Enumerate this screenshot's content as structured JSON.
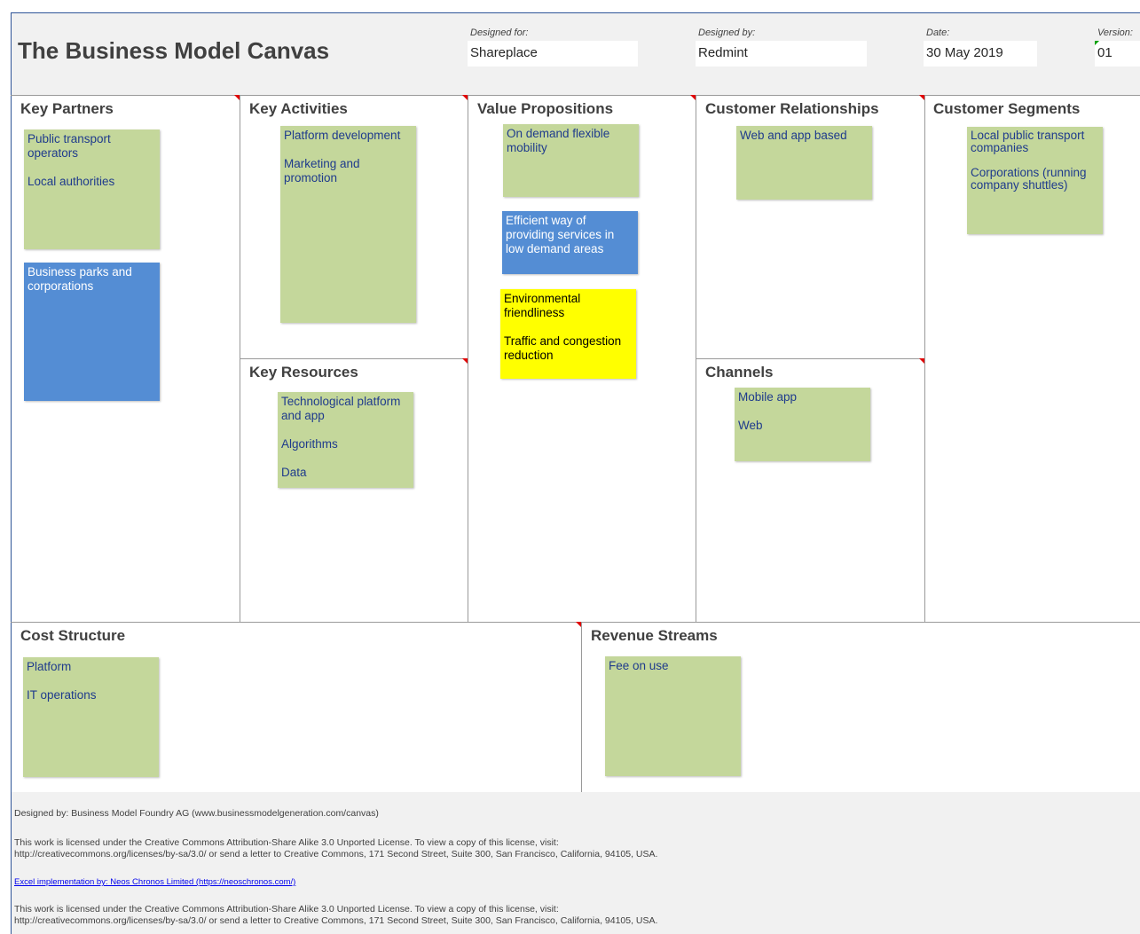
{
  "header": {
    "title": "The Business Model Canvas",
    "designed_for_label": "Designed for:",
    "designed_for_value": "Shareplace",
    "designed_by_label": "Designed by:",
    "designed_by_value": "Redmint",
    "date_label": "Date:",
    "date_value": "30 May 2019",
    "version_label": "Version:",
    "version_value": "01"
  },
  "sections": {
    "key_partners": {
      "title": "Key Partners",
      "notes": [
        {
          "color": "green",
          "lines": [
            "Public transport operators",
            "Local authorities"
          ]
        },
        {
          "color": "blue",
          "lines": [
            "Business parks and corporations"
          ]
        }
      ]
    },
    "key_activities": {
      "title": "Key Activities",
      "notes": [
        {
          "color": "green",
          "lines": [
            "Platform development",
            "Marketing and promotion"
          ]
        }
      ]
    },
    "key_resources": {
      "title": "Key Resources",
      "notes": [
        {
          "color": "green",
          "lines": [
            "Technological platform and app",
            "Algorithms",
            "Data"
          ]
        }
      ]
    },
    "value_propositions": {
      "title": "Value Propositions",
      "notes": [
        {
          "color": "green",
          "lines": [
            "On demand flexible mobility"
          ]
        },
        {
          "color": "blue",
          "lines": [
            "Efficient way of providing services in low demand areas"
          ]
        },
        {
          "color": "yellow",
          "lines": [
            "Environmental friendliness",
            "Traffic and congestion reduction"
          ]
        }
      ]
    },
    "customer_relationships": {
      "title": "Customer Relationships",
      "notes": [
        {
          "color": "green",
          "lines": [
            "Web and app based"
          ]
        }
      ]
    },
    "channels": {
      "title": "Channels",
      "notes": [
        {
          "color": "green",
          "lines": [
            "Mobile app",
            "Web"
          ]
        }
      ]
    },
    "customer_segments": {
      "title": "Customer Segments",
      "notes": [
        {
          "color": "green",
          "lines": [
            "Local public transport companies",
            "Corporations (running company shuttles)"
          ]
        }
      ]
    },
    "cost_structure": {
      "title": "Cost Structure",
      "notes": [
        {
          "color": "green",
          "lines": [
            "Platform",
            "IT operations"
          ]
        }
      ]
    },
    "revenue_streams": {
      "title": "Revenue Streams",
      "notes": [
        {
          "color": "green",
          "lines": [
            "Fee on use"
          ]
        }
      ]
    }
  },
  "footer": {
    "designed_by": "Designed by: Business Model Foundry AG (www.businessmodelgeneration.com/canvas)",
    "license1_line1": "This work is licensed under the Creative Commons Attribution-Share Alike 3.0 Unported License. To view a copy of this license, visit:",
    "license1_line2": "http://creativecommons.org/licenses/by-sa/3.0/ or send a letter to Creative Commons, 171 Second Street, Suite 300, San Francisco, California, 94105, USA.",
    "excel_link": "Excel implementation by: Neos Chronos Limited (https://neoschronos.com/)",
    "license2_line1": "This work is licensed under the Creative Commons Attribution-Share Alike 3.0 Unported License. To view a copy of this license, visit:",
    "license2_line2": "http://creativecommons.org/licenses/by-sa/3.0/ or send a letter to Creative Commons, 171 Second Street, Suite 300, San Francisco, California, 94105, USA."
  },
  "colors": {
    "note_green": "#c4d79b",
    "note_blue": "#548dd4",
    "note_yellow": "#ffff00",
    "border_blue": "#2f5597"
  }
}
